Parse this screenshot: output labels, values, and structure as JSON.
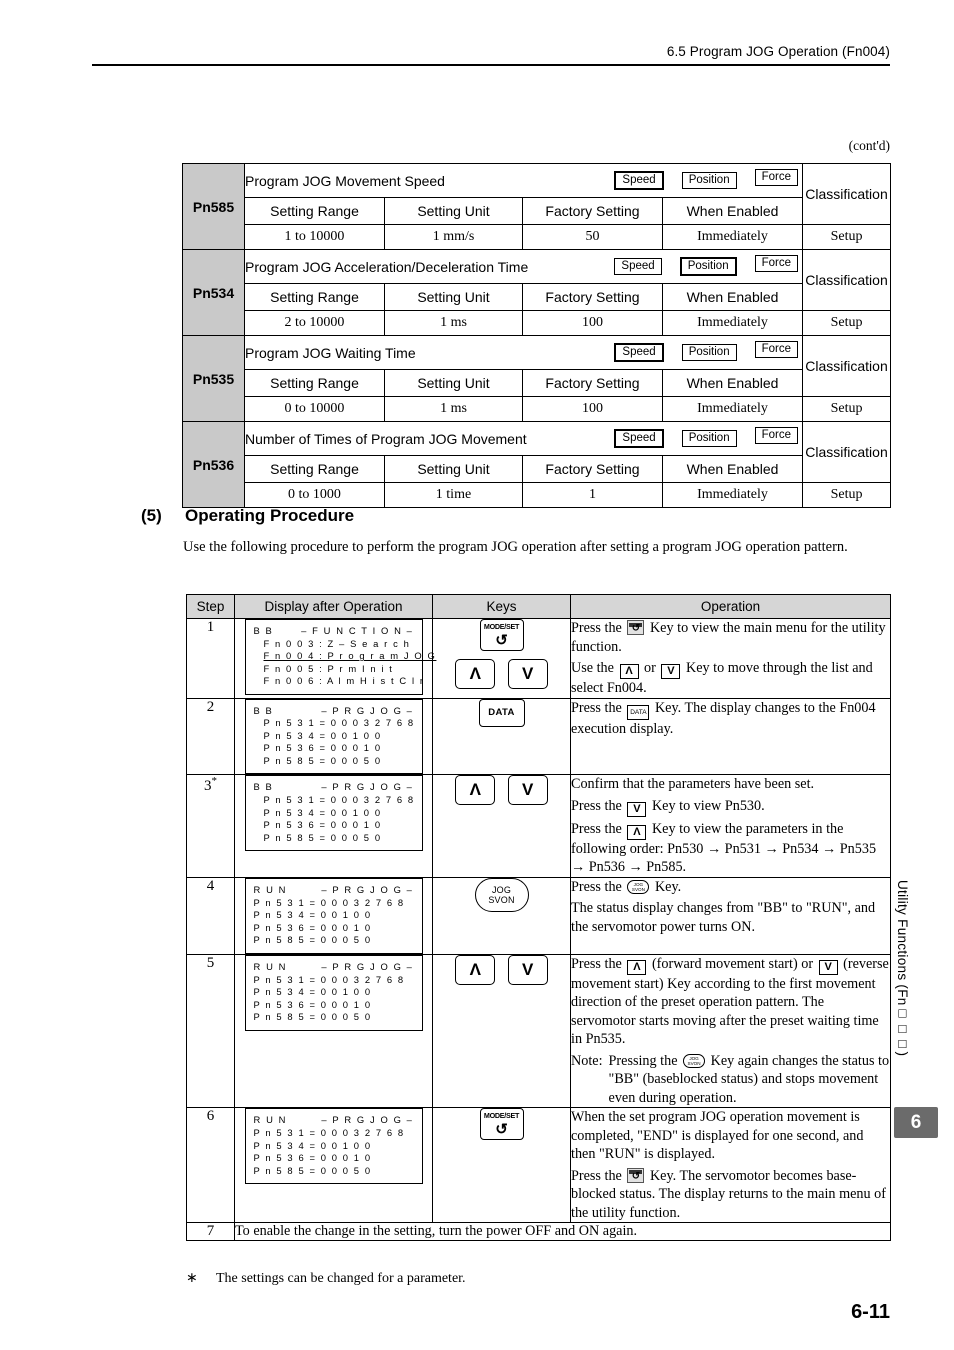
{
  "header": {
    "title": "6.5  Program JOG Operation (Fn004)"
  },
  "contd": "(cont'd)",
  "param_table": {
    "headers": {
      "setting_range": "Setting Range",
      "setting_unit": "Setting Unit",
      "factory_setting": "Factory Setting",
      "when_enabled": "When Enabled",
      "classification": "Classification"
    },
    "badge_labels": {
      "speed": "Speed",
      "position": "Position",
      "force": "Force"
    },
    "rows": [
      {
        "code": "Pn585",
        "name": "Program JOG Movement Speed",
        "active_badge": "speed",
        "setting_range": "1 to 10000",
        "setting_unit": "1 mm/s",
        "factory_setting": "50",
        "when_enabled": "Immediately",
        "classification": "Setup"
      },
      {
        "code": "Pn534",
        "name": "Program JOG Acceleration/Deceleration Time",
        "active_badge": "position",
        "setting_range": "2 to 10000",
        "setting_unit": "1 ms",
        "factory_setting": "100",
        "when_enabled": "Immediately",
        "classification": "Setup"
      },
      {
        "code": "Pn535",
        "name": "Program JOG Waiting Time",
        "active_badge": "speed",
        "setting_range": "0 to 10000",
        "setting_unit": "1 ms",
        "factory_setting": "100",
        "when_enabled": "Immediately",
        "classification": "Setup"
      },
      {
        "code": "Pn536",
        "name": "Number of Times of Program JOG Movement",
        "active_badge": "speed",
        "setting_range": "0 to 1000",
        "setting_unit": "1 time",
        "factory_setting": "1",
        "when_enabled": "Immediately",
        "classification": "Setup"
      }
    ]
  },
  "section": {
    "number": "(5)",
    "title": "Operating Procedure",
    "body": "Use the following procedure to perform the program JOG operation after setting a program JOG operation pattern."
  },
  "procedure": {
    "columns": {
      "step": "Step",
      "display": "Display after Operation",
      "keys": "Keys",
      "operation": "Operation"
    },
    "steps": [
      {
        "step": "1",
        "display": {
          "status": "B B",
          "title": "– F U N C T I O N –",
          "lines": [
            "F n 0 0 3 : Z – S e a r c h",
            "F n 0 0 4 : P r o g r a m   J O G",
            "F n 0 0 5 : P r m   I n i t",
            "F n 0 0 6 : A l m H i s t   C l r"
          ]
        },
        "keys": [
          "modeset",
          "up",
          "down"
        ],
        "operation_line1_a": "Press the",
        "operation_line1_b": "Key to view the main menu for the utility function.",
        "operation_line2_a": "Use the",
        "operation_line2_b": "or",
        "operation_line2_c": "Key to move through the list and select Fn004."
      },
      {
        "step": "2",
        "display": {
          "status": "B B",
          "title": "– P R G   J O G –",
          "lines": [
            "P n 5 3 1 = 0 0 0 3 2 7 6 8",
            "P n 5 3 4 = 0 0 1 0 0",
            "P n 5 3 6 = 0 0 0 1 0",
            "P n 5 8 5 = 0 0 0 5 0"
          ]
        },
        "keys": [
          "data"
        ],
        "operation_line1_a": "Press the",
        "operation_line1_b": "Key. The display changes to the Fn004 execution display."
      },
      {
        "step": "3",
        "step_note": "*",
        "display": {
          "status": "B B",
          "title": "– P R G   J O G –",
          "lines": [
            "P n 5 3 1 = 0 0 0 3 2 7 6 8",
            "P n 5 3 4 = 0 0 1 0 0",
            "P n 5 3 6 = 0 0 0 1 0",
            "P n 5 8 5 = 0 0 0 5 0"
          ]
        },
        "keys": [
          "up",
          "down"
        ],
        "operation_line0": "Confirm that the parameters have been set.",
        "operation_line1_a": "Press the",
        "operation_line1_b": "Key to view Pn530.",
        "operation_line2_a": "Press the",
        "operation_line2_b": "Key to view the parameters in the following order: Pn530 → Pn531 → Pn534 → Pn535 → Pn536 → Pn585."
      },
      {
        "step": "4",
        "display": {
          "status": "R U N",
          "title": "– P R G   J O G –",
          "lines": [
            "P n 5 3 1 = 0 0 0 3 2 7 6 8",
            "P n 5 3 4 = 0 0 1 0 0",
            "P n 5 3 6 = 0 0 0 1 0",
            "P n 5 8 5 = 0 0 0 5 0"
          ]
        },
        "keys": [
          "jogsvon"
        ],
        "operation_line1_a": "Press the",
        "operation_line1_b": "Key.",
        "operation_line2": "The status display changes from \"BB\" to \"RUN\", and the servomotor power turns ON."
      },
      {
        "step": "5",
        "display": {
          "status": "R U N",
          "title": "– P R G   J O G –",
          "lines": [
            "P n 5 3 1 = 0 0 0 3 2 7 6 8",
            "P n 5 3 4 = 0 0 1 0 0",
            "P n 5 3 6 = 0 0 0 1 0",
            "P n 5 8 5 = 0 0 0 5 0"
          ]
        },
        "keys": [
          "up",
          "down"
        ],
        "operation_a": "Press the",
        "operation_b": "(forward movement start) or",
        "operation_c": "(reverse movement start) Key according to the first movement direction of the preset operation pattern. The servomotor starts moving after the preset waiting time in Pn535.",
        "note_label": "Note:",
        "note_a": "Pressing the",
        "note_b": "Key again changes the status to \"BB\" (baseblocked status) and stops movement even during operation."
      },
      {
        "step": "6",
        "display": {
          "status": "R U N",
          "title": "– P R G   J O G –",
          "lines": [
            "P n 5 3 1 = 0 0 0 3 2 7 6 8",
            "P n 5 3 4 = 0 0 1 0 0",
            "P n 5 3 6 = 0 0 0 1 0",
            "P n 5 8 5 = 0 0 0 5 0"
          ]
        },
        "keys": [
          "modeset"
        ],
        "operation_line1": "When the set program JOG operation movement is completed, \"END\" is displayed for one second, and then \"RUN\" is displayed.",
        "operation_line2_a": "Press the",
        "operation_line2_b": "Key. The servomotor becomes base-blocked status. The display returns to the main menu of the utility function."
      }
    ],
    "last_step": {
      "step": "7",
      "text": "To enable the change in the setting, turn the power OFF and ON again."
    }
  },
  "footnote": {
    "marker": "∗",
    "text": "The settings can be changed for a parameter."
  },
  "side_tab": {
    "label": "Utility Functions (Fn□□□)",
    "chapter": "6"
  },
  "page_number": "6-11",
  "keys_legend": {
    "modeset_top": "MODE/SET",
    "data": "DATA",
    "jog_line1": "JOG",
    "jog_line2": "SVON",
    "up": "Λ",
    "down": "V"
  }
}
